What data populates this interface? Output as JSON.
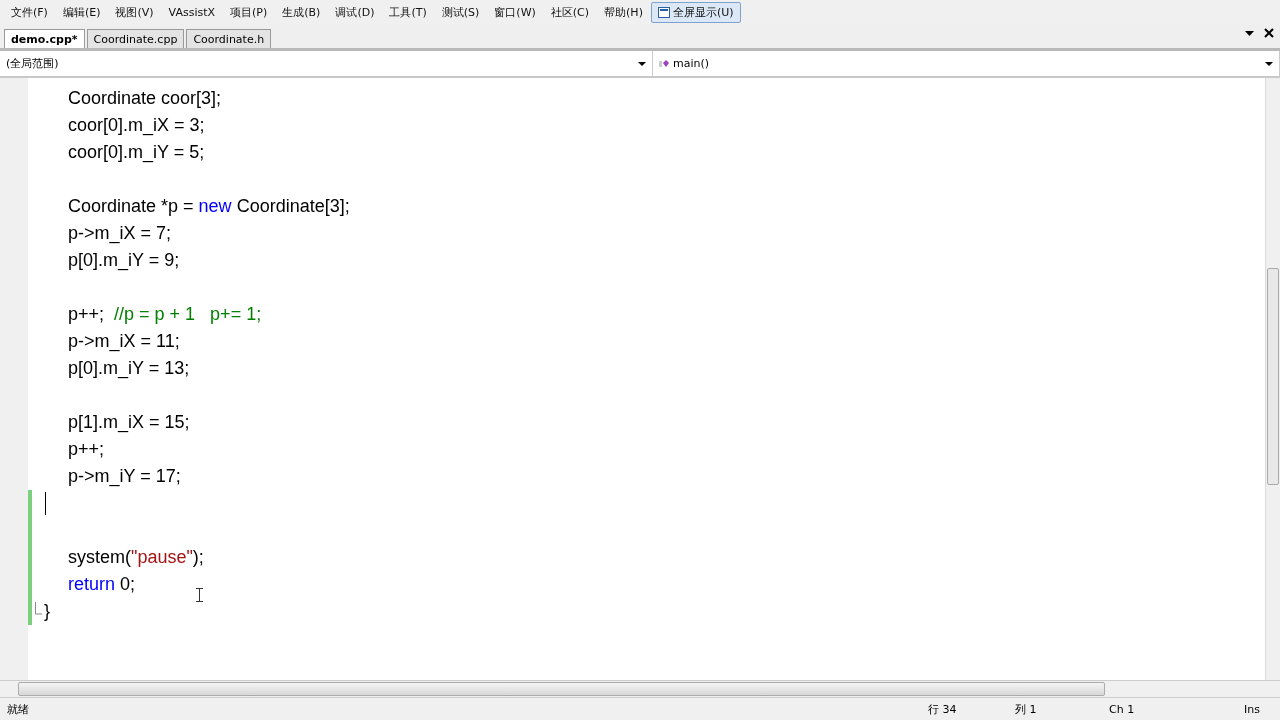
{
  "menu": [
    {
      "label": "文件(F)",
      "selected": false
    },
    {
      "label": "编辑(E)",
      "selected": false
    },
    {
      "label": "视图(V)",
      "selected": false
    },
    {
      "label": "VAssistX",
      "selected": false
    },
    {
      "label": "项目(P)",
      "selected": false
    },
    {
      "label": "生成(B)",
      "selected": false
    },
    {
      "label": "调试(D)",
      "selected": false
    },
    {
      "label": "工具(T)",
      "selected": false
    },
    {
      "label": "测试(S)",
      "selected": false
    },
    {
      "label": "窗口(W)",
      "selected": false
    },
    {
      "label": "社区(C)",
      "selected": false
    },
    {
      "label": "帮助(H)",
      "selected": false
    },
    {
      "label": "全屏显示(U)",
      "selected": true
    }
  ],
  "tabs": [
    {
      "label": "demo.cpp*",
      "selected": true
    },
    {
      "label": "Coordinate.cpp",
      "selected": false
    },
    {
      "label": "Coordinate.h",
      "selected": false
    }
  ],
  "scope": {
    "left": "(全局范围)",
    "right": "main()"
  },
  "code": [
    {
      "kind": "code",
      "changed": false,
      "cursor": false,
      "tokens": [
        {
          "kind": "plain",
          "text": "Coordinate coor[3];"
        }
      ]
    },
    {
      "kind": "code",
      "changed": false,
      "cursor": false,
      "tokens": [
        {
          "kind": "plain",
          "text": "coor[0].m_iX = 3;"
        }
      ]
    },
    {
      "kind": "code",
      "changed": false,
      "cursor": false,
      "tokens": [
        {
          "kind": "plain",
          "text": "coor[0].m_iY = 5;"
        }
      ]
    },
    {
      "kind": "code",
      "changed": false,
      "cursor": false
    },
    {
      "kind": "code",
      "changed": false,
      "cursor": false,
      "tokens": [
        {
          "kind": "plain",
          "text": "Coordinate *p = "
        },
        {
          "kind": "keyword",
          "text": "new"
        },
        {
          "kind": "plain",
          "text": " Coordinate[3];"
        }
      ]
    },
    {
      "kind": "code",
      "changed": false,
      "cursor": false,
      "tokens": [
        {
          "kind": "plain",
          "text": "p->m_iX = 7;"
        }
      ]
    },
    {
      "kind": "code",
      "changed": false,
      "cursor": false,
      "tokens": [
        {
          "kind": "plain",
          "text": "p[0].m_iY = 9;"
        }
      ]
    },
    {
      "kind": "code",
      "changed": false,
      "cursor": false
    },
    {
      "kind": "code",
      "changed": false,
      "cursor": false,
      "tokens": [
        {
          "kind": "plain",
          "text": "p++;  "
        },
        {
          "kind": "comment",
          "text": "//p = p + 1   p+= 1;"
        }
      ]
    },
    {
      "kind": "code",
      "changed": false,
      "cursor": false,
      "tokens": [
        {
          "kind": "plain",
          "text": "p->m_iX = 11;"
        }
      ]
    },
    {
      "kind": "code",
      "changed": false,
      "cursor": false,
      "tokens": [
        {
          "kind": "plain",
          "text": "p[0].m_iY = 13;"
        }
      ]
    },
    {
      "kind": "code",
      "changed": false,
      "cursor": false
    },
    {
      "kind": "code",
      "changed": false,
      "cursor": false,
      "tokens": [
        {
          "kind": "plain",
          "text": "p[1].m_iX = 15;"
        }
      ]
    },
    {
      "kind": "code",
      "changed": false,
      "cursor": false,
      "tokens": [
        {
          "kind": "plain",
          "text": "p++;"
        }
      ]
    },
    {
      "kind": "code",
      "changed": false,
      "cursor": false,
      "tokens": [
        {
          "kind": "plain",
          "text": "p->m_iY = 17;"
        }
      ]
    },
    {
      "kind": "code",
      "changed": true,
      "cursor": true
    },
    {
      "kind": "code",
      "changed": true,
      "cursor": false
    },
    {
      "kind": "code",
      "changed": true,
      "cursor": false,
      "tokens": [
        {
          "kind": "plain",
          "text": "system("
        },
        {
          "kind": "string",
          "text": "\"pause\""
        },
        {
          "kind": "plain",
          "text": ");"
        }
      ]
    },
    {
      "kind": "code",
      "changed": true,
      "cursor": false,
      "tokens": [
        {
          "kind": "keyword",
          "text": "return"
        },
        {
          "kind": "plain",
          "text": " 0;"
        }
      ]
    },
    {
      "kind": "close",
      "changed": true,
      "cursor": false,
      "tokens": [
        {
          "kind": "plain",
          "text": "}"
        }
      ]
    }
  ],
  "status_bar": {
    "message": "就绪",
    "line": "行 34",
    "column": "列 1",
    "char": "Ch 1",
    "mode": "Ins"
  }
}
